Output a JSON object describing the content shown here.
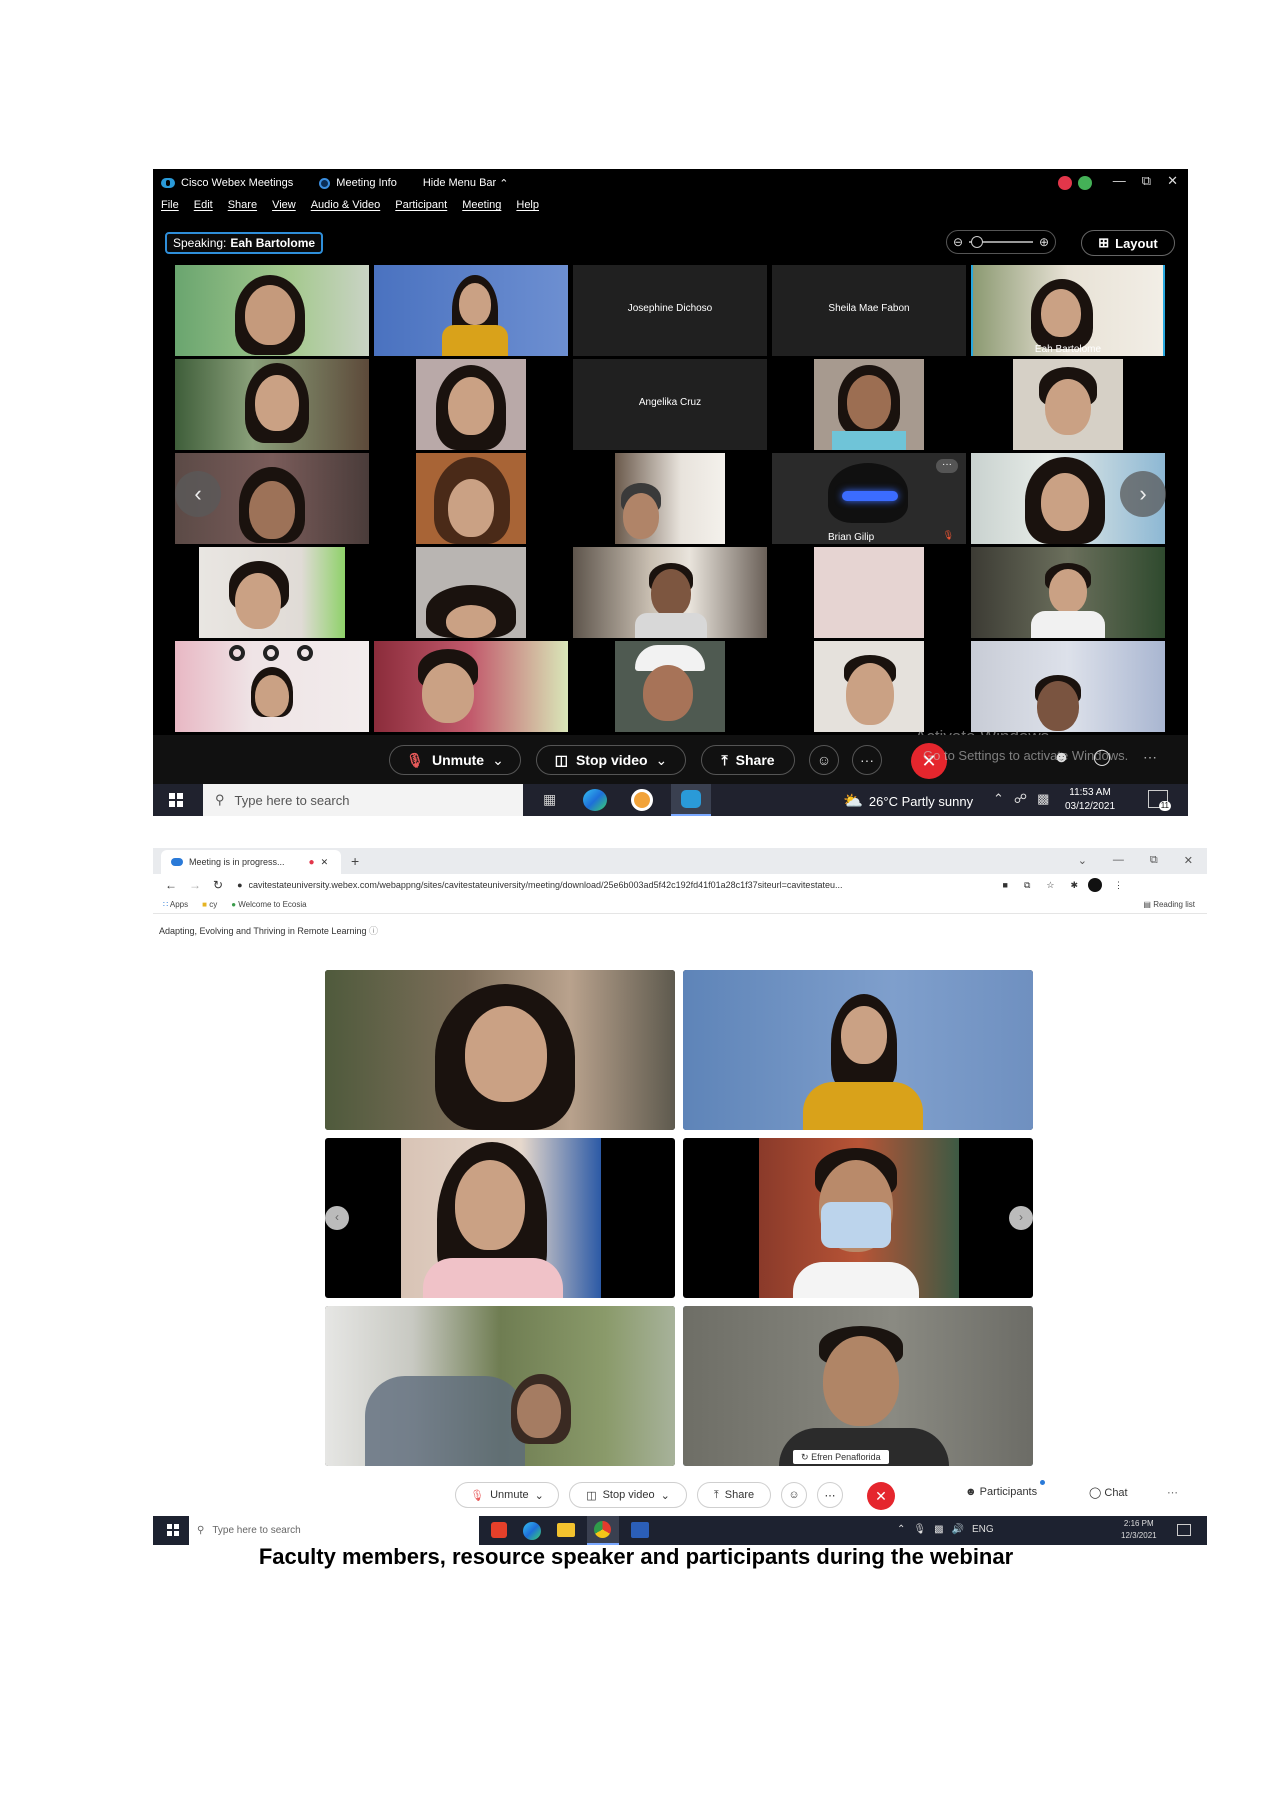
{
  "webex_desktop": {
    "title_app": "Cisco Webex Meetings",
    "title_info": "Meeting Info",
    "title_hide": "Hide Menu Bar",
    "menu": [
      "File",
      "Edit",
      "Share",
      "View",
      "Audio & Video",
      "Participant",
      "Meeting",
      "Help"
    ],
    "speaking_label": "Speaking:",
    "speaking_name": "Eah Bartolome",
    "layout_label": "Layout",
    "tiles": {
      "josephine": "Josephine Dichoso",
      "sheila": "Sheila Mae Fabon",
      "eah": "Eah Bartolome",
      "angelika": "Angelika Cruz",
      "brian": "Brian Gilip"
    },
    "toolbar": {
      "unmute": "Unmute",
      "stop_video": "Stop video",
      "share": "Share",
      "more": "···"
    },
    "watermark_line1": "Activate Windows",
    "watermark_line2": "Go to Settings to activate Windows.",
    "taskbar": {
      "search_placeholder": "Type here to search",
      "weather": "26°C  Partly sunny",
      "time": "11:53 AM",
      "date": "03/12/2021",
      "notif_count": "11"
    },
    "colors": {
      "speaking_border": "#2f8fda",
      "end_call": "#e5262d",
      "active_tile": "#28a9e0"
    }
  },
  "webex_browser": {
    "tab_title": "Meeting is in progress...",
    "url": "cavitestateuniversity.webex.com/webappng/sites/cavitestateuniversity/meeting/download/25e6b003ad5f42c192fd41f01a28c1f37siteurl=cavitestateu...",
    "bookmarks": [
      "Apps",
      "cy",
      "Welcome to Ecosia"
    ],
    "reading_list": "Reading list",
    "meeting_title": "Adapting, Evolving and Thriving in Remote Learning",
    "speaker_name": "Efren Penaflorida",
    "toolbar": {
      "unmute": "Unmute",
      "stop_video": "Stop video",
      "share": "Share",
      "participants": "Participants",
      "chat": "Chat"
    },
    "taskbar": {
      "search_placeholder": "Type here to search",
      "lang": "ENG",
      "time": "2:16 PM",
      "date": "12/3/2021"
    }
  },
  "caption": "Faculty members, resource speaker and participants during the webinar"
}
